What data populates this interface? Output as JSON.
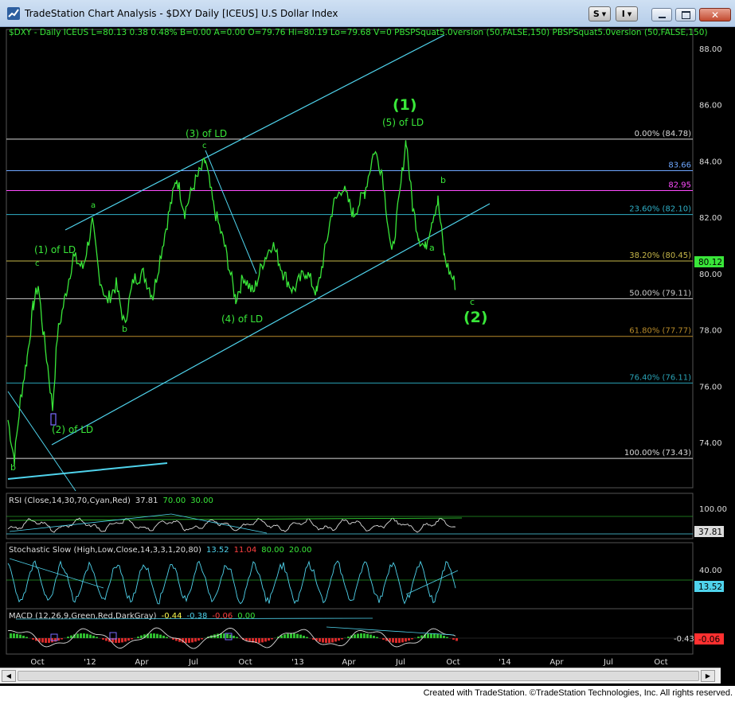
{
  "window": {
    "title": "TradeStation Chart Analysis - $DXY Daily [ICEUS] U.S Dollar Index",
    "toolbar_buttons": [
      {
        "label": "S",
        "icon": "chevron-down-icon"
      },
      {
        "label": "I",
        "icon": "chevron-down-icon"
      }
    ],
    "window_controls": [
      "minimize-icon",
      "restore-icon",
      "close-icon"
    ]
  },
  "header": {
    "symbol_line": "$DXY - Daily ICEUS L=80.13 0.38 0.48% B=0.00 A=0.00 O=79.76 Hi=80.19 Lo=79.68 V=0 PBSPSquat5.0version (50,FALSE,150) PBSPSquat5.0version (50,FALSE,150)"
  },
  "price_axis": {
    "ticks": [
      "88.00",
      "86.00",
      "84.00",
      "82.00",
      "80.00",
      "78.00",
      "76.00",
      "74.00"
    ],
    "last_price": "80.12"
  },
  "levels": [
    {
      "label": "0.00% (84.78)",
      "value": 84.78,
      "color": "#d8d8d8"
    },
    {
      "label": "83.66",
      "value": 83.66,
      "color": "#6ea7ff"
    },
    {
      "label": "82.95",
      "value": 82.95,
      "color": "#ff4cff"
    },
    {
      "label": "23.60% (82.10)",
      "value": 82.1,
      "color": "#2fb0c8"
    },
    {
      "label": "38.20% (80.45)",
      "value": 80.45,
      "color": "#c8b84a"
    },
    {
      "label": "50.00% (79.11)",
      "value": 79.11,
      "color": "#c9c9c9"
    },
    {
      "label": "61.80% (77.77)",
      "value": 77.77,
      "color": "#b88b2a"
    },
    {
      "label": "76.40% (76.11)",
      "value": 76.11,
      "color": "#2aa3b6"
    },
    {
      "label": "100.00% (73.43)",
      "value": 73.43,
      "color": "#d8d8d8"
    }
  ],
  "wave_labels": {
    "w1_ld": "(1) of LD",
    "c1": "c",
    "a1": "a",
    "b1": "b",
    "b2": "b",
    "w2_ld": "(2) of LD",
    "w3_ld": "(3) of LD",
    "c3": "c",
    "w4_ld": "(4) of LD",
    "w5_ld": "(5) of LD",
    "big1": "(1)",
    "b3": "b",
    "a3": "a",
    "c4": "c",
    "big2": "(2)"
  },
  "rsi": {
    "header": "RSI (Close,14,30,70,Cyan,Red)",
    "value": "37.81",
    "high": "70.00",
    "low": "30.00",
    "axis_top": "100.00",
    "last_value": "37.81"
  },
  "stochastic": {
    "header": "Stochastic Slow (High,Low,Close,14,3,3,1,20,80)",
    "k": "13.52",
    "d": "11.04",
    "high": "80.00",
    "low": "20.00",
    "axis_tick": "40.00",
    "last_value": "13.52"
  },
  "macd": {
    "header": "MACD (12,26,9,Green,Red,DarkGray)",
    "macd": "-0.44",
    "signal": "-0.38",
    "hist": "-0.06",
    "zero": "0.00",
    "axis_left": "-0.43",
    "axis_right": "-0.06"
  },
  "time_axis": {
    "labels": [
      "Oct",
      "'12",
      "Apr",
      "Jul",
      "Oct",
      "'13",
      "Apr",
      "Jul",
      "Oct",
      "'14",
      "Apr",
      "Jul",
      "Oct"
    ]
  },
  "footer": {
    "text": "Created with TradeStation. ©TradeStation Technologies, Inc. All rights reserved."
  }
}
